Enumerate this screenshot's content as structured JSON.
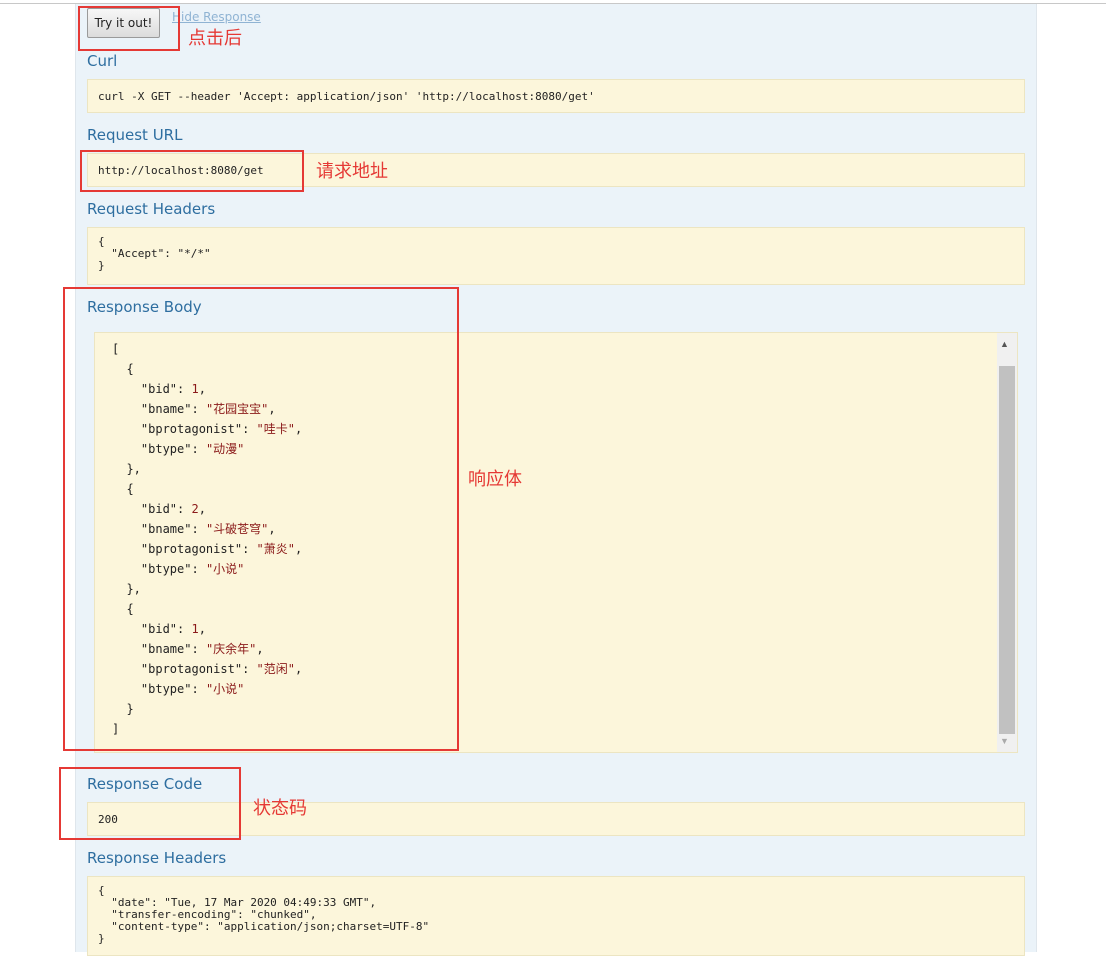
{
  "actions": {
    "try_button": "Try it out!",
    "hide_link": "Hide Response"
  },
  "curl": {
    "label": "Curl",
    "command": "curl -X GET --header 'Accept: application/json' 'http://localhost:8080/get'"
  },
  "request_url": {
    "label": "Request URL",
    "value": "http://localhost:8080/get"
  },
  "request_headers": {
    "label": "Request Headers",
    "text": "{\n  \"Accept\": \"*/*\"\n}"
  },
  "response_body": {
    "label": "Response Body",
    "items": [
      {
        "bid": 1,
        "bname": "花园宝宝",
        "bprotagonist": "哇卡",
        "btype": "动漫"
      },
      {
        "bid": 2,
        "bname": "斗破苍穹",
        "bprotagonist": "萧炎",
        "btype": "小说"
      },
      {
        "bid": 1,
        "bname": "庆余年",
        "bprotagonist": "范闲",
        "btype": "小说"
      }
    ]
  },
  "response_code": {
    "label": "Response Code",
    "value": "200"
  },
  "response_headers": {
    "label": "Response Headers",
    "text": "{\n  \"date\": \"Tue, 17 Mar 2020 04:49:33 GMT\",\n  \"transfer-encoding\": \"chunked\",\n  \"content-type\": \"application/json;charset=UTF-8\"\n}"
  },
  "annotations": {
    "after_click": "点击后",
    "request_address": "请求地址",
    "response_body": "响应体",
    "status_code": "状态码"
  },
  "colors": {
    "label": "#2e6ea0",
    "box_bg": "#fcf6db",
    "panel_bg": "#ebf3f9",
    "annotation": "#e53935"
  }
}
